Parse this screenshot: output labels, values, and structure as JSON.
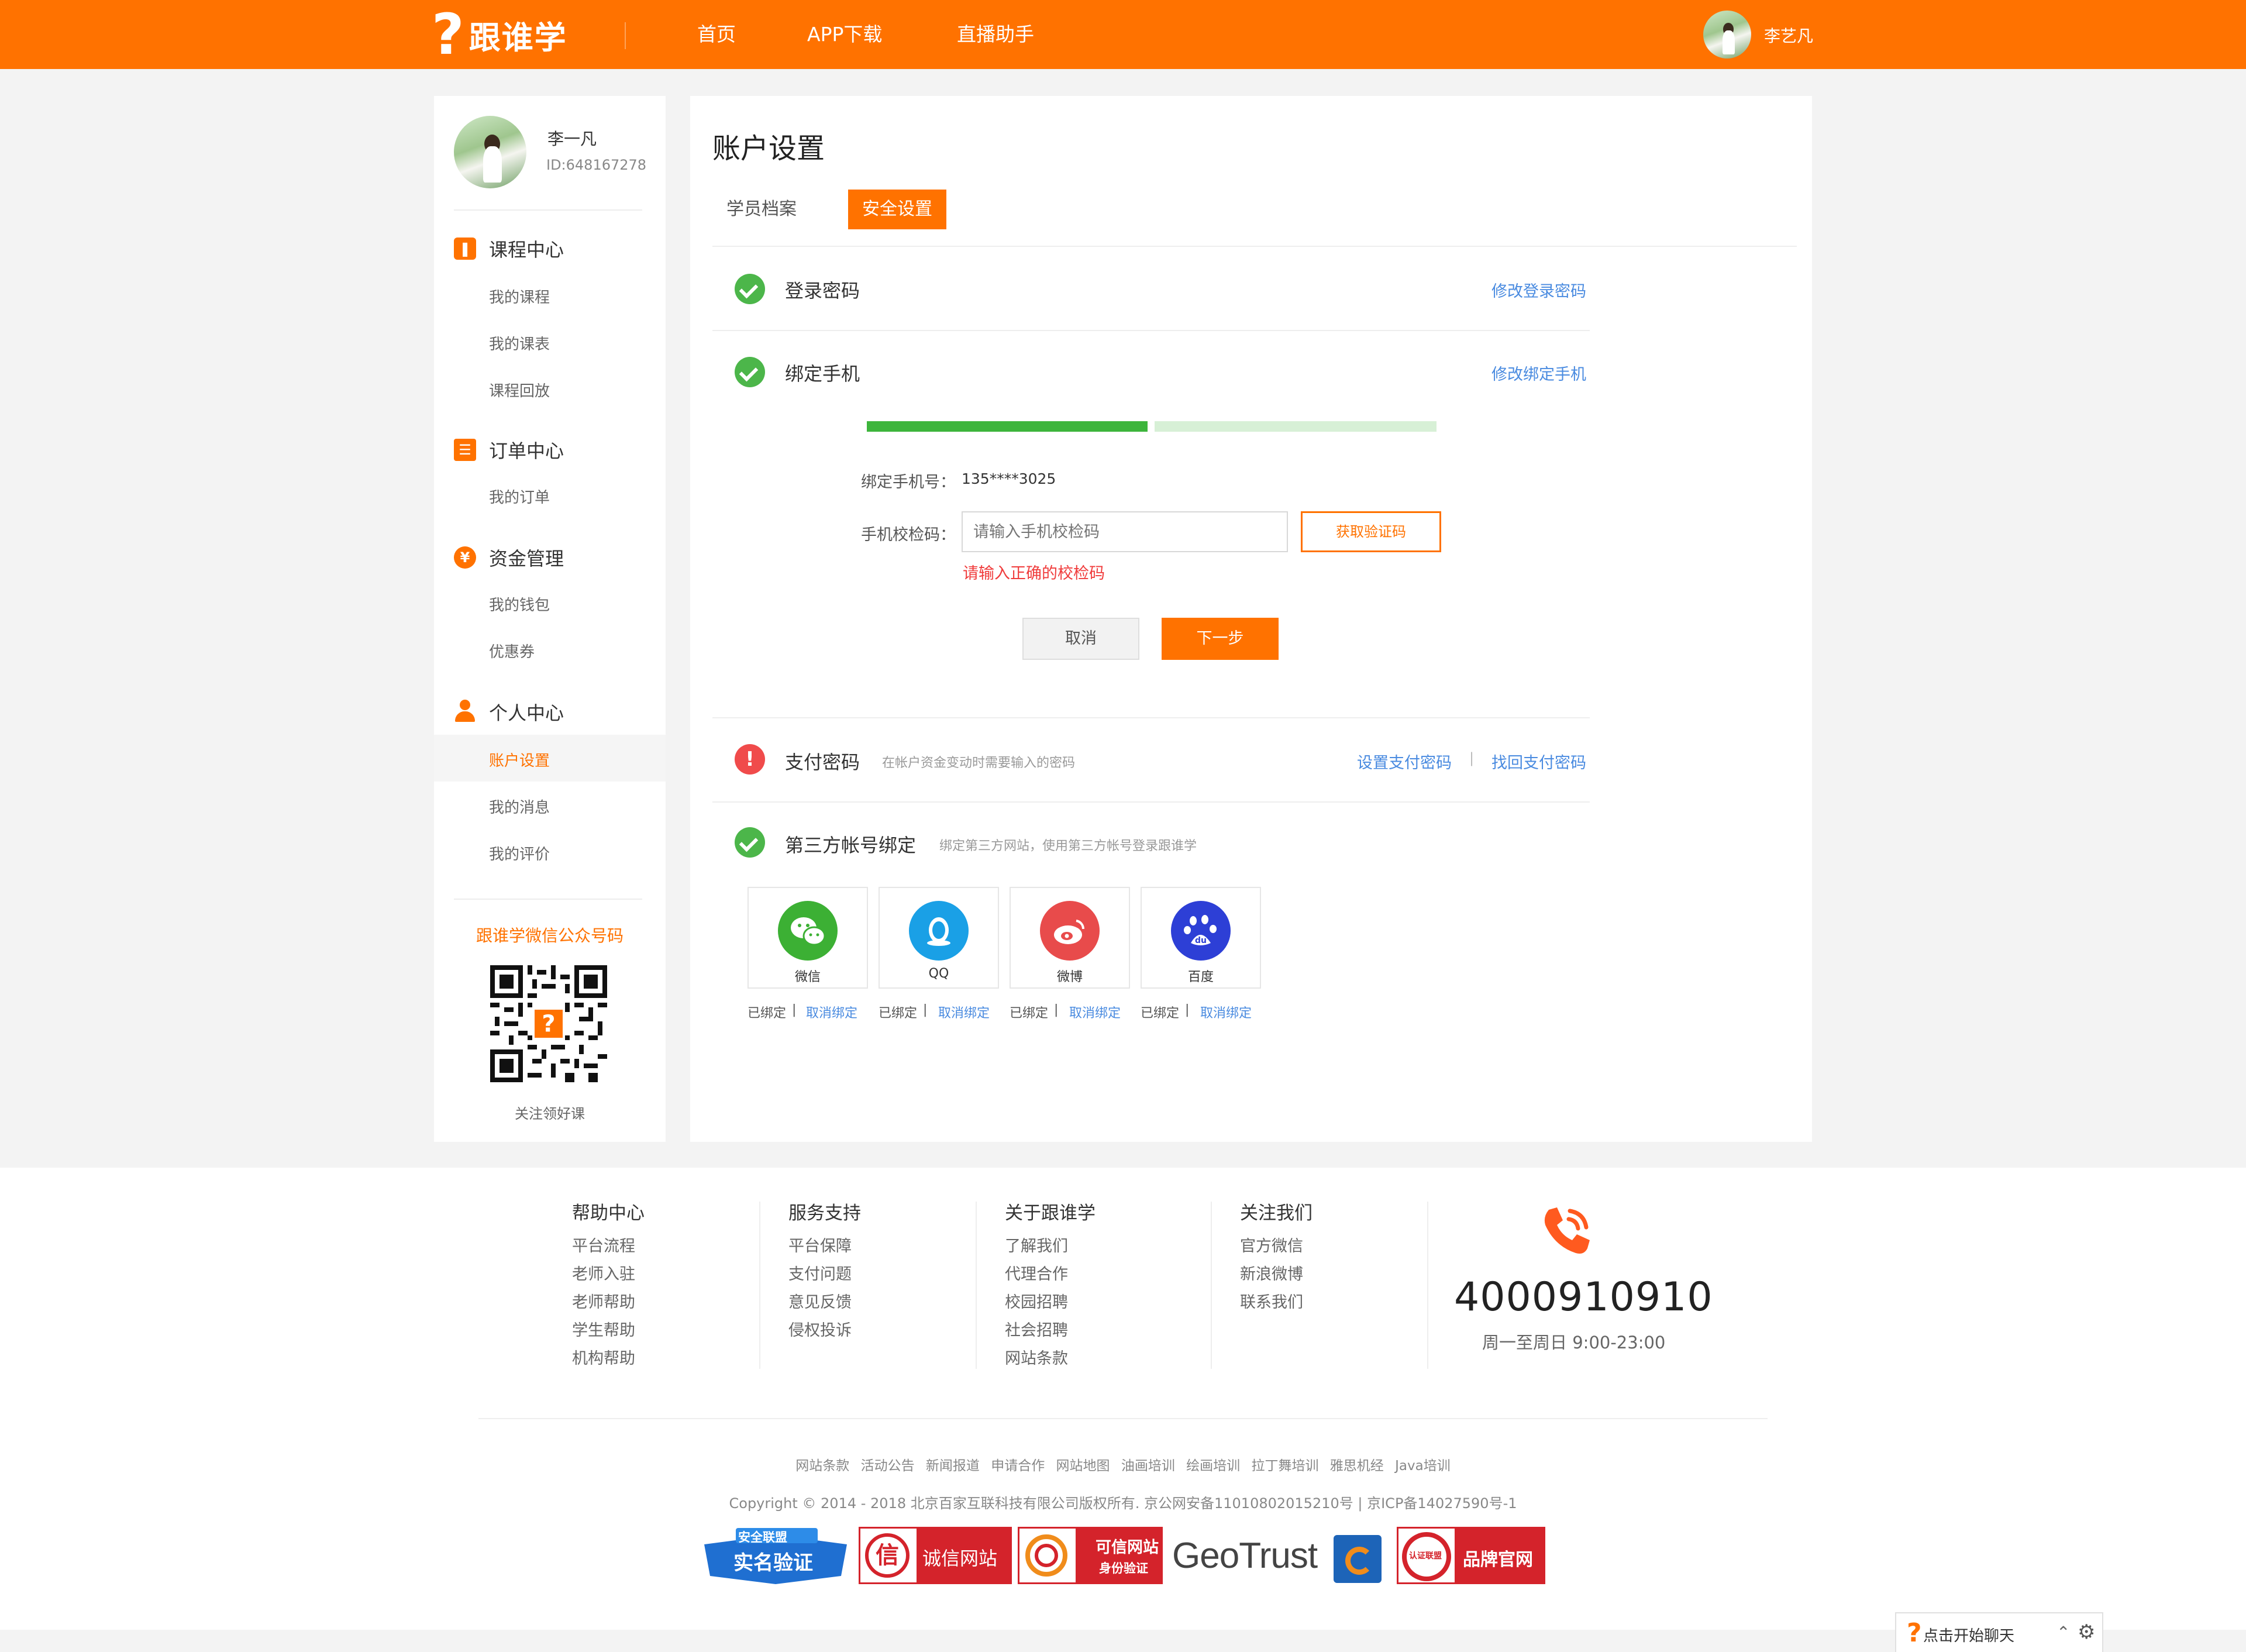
{
  "header": {
    "logo_mark": "?",
    "logo_text": "跟谁学",
    "nav": [
      "首页",
      "APP下载",
      "直播助手"
    ],
    "user_name": "李艺凡"
  },
  "sidebar": {
    "profile_name": "李一凡",
    "profile_id": "ID:648167278",
    "sections": [
      {
        "icon": "book-icon",
        "title": "课程中心",
        "links": [
          "我的课程",
          "我的课表",
          "课程回放"
        ]
      },
      {
        "icon": "order-icon",
        "title": "订单中心",
        "links": [
          "我的订单"
        ]
      },
      {
        "icon": "yuan-icon",
        "title": "资金管理",
        "links": [
          "我的钱包",
          "优惠券"
        ]
      },
      {
        "icon": "person-icon",
        "title": "个人中心",
        "links": [
          "账户设置",
          "我的消息",
          "我的评价"
        ]
      }
    ],
    "active_link": "账户设置",
    "qr_title": "跟谁学微信公众号码",
    "qr_caption": "关注领好课"
  },
  "main": {
    "title": "账户设置",
    "tabs": [
      "学员档案",
      "安全设置"
    ],
    "active_tab": "安全设置",
    "login_password": {
      "title": "登录密码",
      "action": "修改登录密码"
    },
    "phone": {
      "title": "绑定手机",
      "action": "修改绑定手机",
      "progress_step": 1,
      "progress_total": 2,
      "phone_label": "绑定手机号：",
      "phone_value": "135****3025",
      "code_label": "手机校检码：",
      "code_placeholder": "请输入手机校检码",
      "get_code": "获取验证码",
      "error": "请输入正确的校检码",
      "cancel": "取消",
      "next": "下一步"
    },
    "pay_password": {
      "title": "支付密码",
      "hint": "在帐户资金变动时需要输入的密码",
      "action_set": "设置支付密码",
      "divider": "|",
      "action_recover": "找回支付密码"
    },
    "third_party": {
      "title": "第三方帐号绑定",
      "hint": "绑定第三方网站，使用第三方帐号登录跟谁学",
      "accounts": [
        {
          "name": "微信",
          "icon": "wechat-icon",
          "color": "#3cb034",
          "status": "已绑定",
          "divider": "|",
          "cancel": "取消绑定"
        },
        {
          "name": "QQ",
          "icon": "qq-icon",
          "color": "#1aa0e6",
          "status": "已绑定",
          "divider": "|",
          "cancel": "取消绑定"
        },
        {
          "name": "微博",
          "icon": "weibo-icon",
          "color": "#e84b4b",
          "status": "已绑定",
          "divider": "|",
          "cancel": "取消绑定"
        },
        {
          "name": "百度",
          "icon": "baidu-icon",
          "color": "#2d3fd6",
          "status": "已绑定",
          "divider": "|",
          "cancel": "取消绑定"
        }
      ]
    }
  },
  "footer": {
    "columns": [
      {
        "title": "帮助中心",
        "links": [
          "平台流程",
          "老师入驻",
          "老师帮助",
          "学生帮助",
          "机构帮助"
        ]
      },
      {
        "title": "服务支持",
        "links": [
          "平台保障",
          "支付问题",
          "意见反馈",
          "侵权投诉"
        ]
      },
      {
        "title": "关于跟谁学",
        "links": [
          "了解我们",
          "代理合作",
          "校园招聘",
          "社会招聘",
          "网站条款"
        ]
      },
      {
        "title": "关注我们",
        "links": [
          "官方微信",
          "新浪微博",
          "联系我们"
        ]
      }
    ],
    "phone": "4000910910",
    "hours": "周一至周日 9:00-23:00",
    "bottom_links": [
      "网站条款",
      "活动公告",
      "新闻报道",
      "申请合作",
      "网站地图",
      "油画培训",
      "绘画培训",
      "拉丁舞培训",
      "雅思机经",
      "Java培训"
    ],
    "copyright": "Copyright © 2014 - 2018 北京百家互联科技有限公司版权所有. 京公网安备11010802015210号 | 京ICP备14027590号-1",
    "badges": {
      "anquan_top": "安全联盟",
      "anquan_main": "实名验证",
      "chengxin": "诚信网站",
      "kexin_top": "可信网站",
      "kexin_bottom": "身份验证",
      "geotrust": "GeoTrust",
      "brand": "品牌官网",
      "renzheng": "认证联盟"
    }
  },
  "chat": {
    "label": "点击开始聊天"
  },
  "colors": {
    "brand": "#ff7200",
    "link": "#4a8be0",
    "success": "#4cb64a",
    "danger": "#f04b4b"
  }
}
